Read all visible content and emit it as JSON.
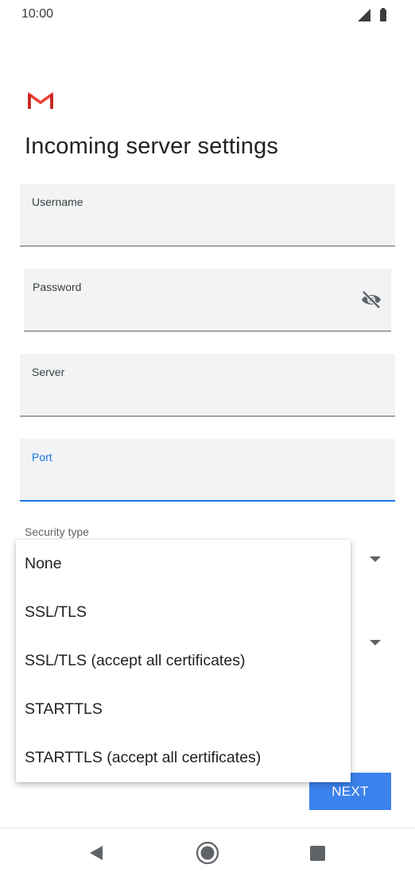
{
  "status_bar": {
    "time": "10:00",
    "icons": [
      "signal-icon",
      "battery-icon"
    ]
  },
  "app": {
    "logo_icon": "gmail-logo-icon",
    "accent_color": "#1a73e8",
    "logo_color": "#ea4335"
  },
  "page": {
    "title": "Incoming server settings"
  },
  "form": {
    "username": {
      "label": "Username",
      "value": ""
    },
    "password": {
      "label": "Password",
      "value": "",
      "toggle_icon": "visibility-off-icon"
    },
    "server": {
      "label": "Server",
      "value": ""
    },
    "port": {
      "label": "Port",
      "value": "",
      "focused": true
    },
    "security": {
      "label": "Security type"
    }
  },
  "dropdown": {
    "options": [
      "None",
      "SSL/TLS",
      "SSL/TLS (accept all certificates)",
      "STARTTLS",
      "STARTTLS (accept all certificates)"
    ]
  },
  "actions": {
    "next_label": "NEXT",
    "next_color": "#3b82ec"
  },
  "nav_bar": {
    "icons": [
      "back-icon",
      "home-icon",
      "recents-icon"
    ]
  }
}
